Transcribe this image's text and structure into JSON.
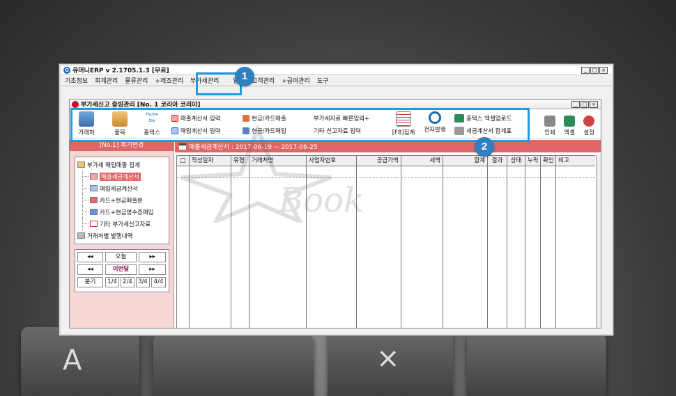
{
  "background_keys": [
    "A",
    "×"
  ],
  "app": {
    "title": "큐머니ERP  v 2.1705.1.3 [무료]",
    "window_controls": [
      "_",
      "□",
      "×"
    ]
  },
  "menu": [
    "기초정보",
    "회계관리",
    "물류관리",
    "+제조관리",
    "부가세관리",
    "발주",
    "고객관리",
    "+급여관리",
    "도구"
  ],
  "subwindow": {
    "title": "부가세신고 증빙관리 [No. 1 코리아 코리아]",
    "window_controls": [
      "_",
      "□",
      "×"
    ]
  },
  "toolbar": {
    "client": "거래처",
    "item": "품목",
    "hometax": "홈택스",
    "sales_invoice_input": "매출계산서 입력",
    "purchase_invoice_input": "매입계산서 입력",
    "cash_card_sales": "현금/카드매출",
    "cash_card_purchase": "현금/카드매입",
    "vat_quick_input": "부가세자료 빠른입력+",
    "other_report_input": "기타 신고자료 입력",
    "f8_total": "[F8]집계",
    "e_issue": "전자발행",
    "hometax_excel_upload": "홈택스 엑셀업로드",
    "invoice_summary": "세금계산서 합계표",
    "print": "인쇄",
    "excel": "엑셀",
    "settings": "설정",
    "hometax_icon_text": "Home tax"
  },
  "sidebar": {
    "header": "[No.1] 회기변경",
    "tree": {
      "root": "부가세 매입매출 집계",
      "children": [
        "매출세금계산서",
        "매입세금계산서",
        "카드+현금매출분",
        "카드+현금영수증매입",
        "기타 부가세신고자료"
      ],
      "last": "거래처별 발행내역"
    },
    "period": {
      "prev": "◂◂",
      "next": "▸▸",
      "today": "오늘",
      "this_month": "이번달",
      "quarter": "분기",
      "quarters": [
        "1/4",
        "2/4",
        "3/4",
        "4/4"
      ]
    }
  },
  "main": {
    "header": "매출세금계산서 : 2017-06-19 ~ 2017-06-25",
    "columns": [
      "□",
      "작성일자",
      "유형",
      "거래처명",
      "사업자번호",
      "공급가액",
      "세액",
      "합계",
      "결과",
      "상태",
      "누락",
      "확인",
      "비고"
    ]
  },
  "watermark": "Book",
  "markers": [
    "1",
    "2"
  ],
  "colors": {
    "highlight": "#1e9be0",
    "marker": "#2f7fc1",
    "header_red": "#e06565",
    "sidebar_pink": "#f7d6d6"
  }
}
